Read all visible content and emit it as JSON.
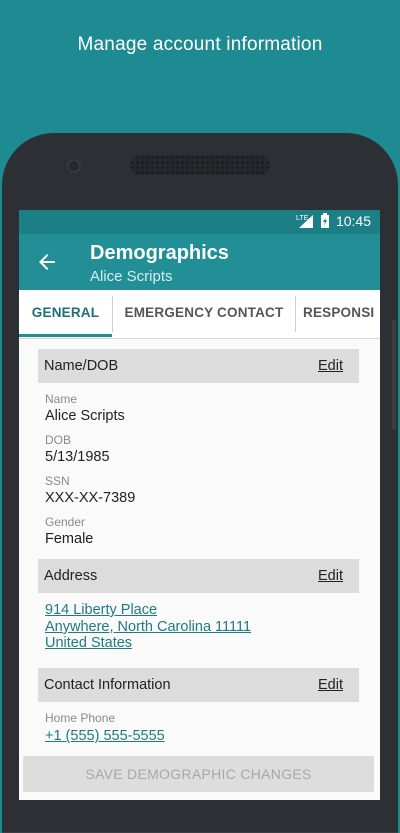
{
  "caption": "Manage account information",
  "status": {
    "network": "LTE",
    "time": "10:45"
  },
  "appbar": {
    "title": "Demographics",
    "subtitle": "Alice Scripts"
  },
  "tabs": [
    {
      "label": "GENERAL",
      "active": true
    },
    {
      "label": "EMERGENCY CONTACT",
      "active": false
    },
    {
      "label": "RESPONSI",
      "active": false
    }
  ],
  "sections": {
    "name_dob": {
      "header": "Name/DOB",
      "edit": "Edit",
      "fields": [
        {
          "label": "Name",
          "value": "Alice Scripts"
        },
        {
          "label": "DOB",
          "value": "5/13/1985"
        },
        {
          "label": "SSN",
          "value": "XXX-XX-7389"
        },
        {
          "label": "Gender",
          "value": "Female"
        }
      ]
    },
    "address": {
      "header": "Address",
      "edit": "Edit",
      "lines": [
        "914 Liberty Place",
        "Anywhere, North Carolina 11111",
        "United States"
      ]
    },
    "contact": {
      "header": "Contact Information",
      "edit": "Edit",
      "home_phone_label": "Home Phone",
      "home_phone": "+1 (555) 555-5555"
    }
  },
  "save_button": "SAVE DEMOGRAPHIC CHANGES",
  "colors": {
    "brand": "#228f96",
    "background": "#1e8b92",
    "link": "#1f7a82"
  }
}
